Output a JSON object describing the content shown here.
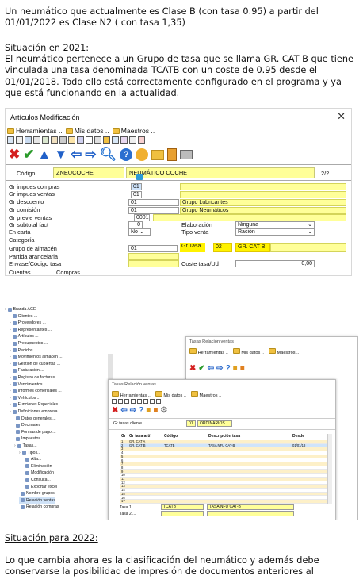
{
  "intro": "Un neumático que actualmente es Clase B (con tasa 0.95) a partir del 01/01/2022 es Clase N2 ( con tasa 1,35)",
  "h2021": "Situación en 2021:",
  "p2021": "El neumático pertenece a un Grupo de tasa que se llama GR. CAT B que tiene vinculada una tasa denominada TCATB con un coste de 0.95 desde el 01/01/2018. Todo ello está correctamente configurado en el programa y ya que está funcionando en la actualidad.",
  "w1": {
    "title": "Artículos Modificación",
    "menu": [
      "Herramientas ..",
      "Mis datos ..",
      "Maestros .."
    ],
    "codigo_label": "Código",
    "codigo": "ZNEUCOCHE",
    "desc": "NEUMÁTICO COCHE",
    "page": "2/2",
    "labels": [
      "Gr impues compras",
      "Gr impues ventas",
      "Gr descuento",
      "Gr comisión",
      "Gr previe ventas",
      "Gr subtotal fact",
      "En carta",
      "Categoría",
      "Grupo de almacén",
      "Partida arancelaria",
      "Envase/Código tasa",
      "Cuentas",
      "Compras"
    ],
    "v_imp_compras": "01",
    "v_imp_ventas": "01",
    "v_desc": "01",
    "v_com": "01",
    "v_previe": "0001",
    "v_subtotal": "0",
    "v_carta": "No",
    "v_almacen": "01",
    "grupo_lub": "Grupo Lubricantes",
    "grupo_neu": "Grupo Neumáticos",
    "elab_label": "Elaboración",
    "elab": "Ninguna",
    "tipoventa_label": "Tipo venta",
    "tipoventa": "Ración",
    "grtasa_label": "Gr Tasa",
    "grtasa_code": "02",
    "grtasa_name": "GR. CAT B",
    "coste_label": "Coste tasa/Ud",
    "coste": "0,00"
  },
  "w2": {
    "tree": [
      "Branda AGE",
      "Clientes ...",
      "Proveedores ...",
      "Representantes ...",
      "Artículos ...",
      "Presupuestos ...",
      "Pedidos ...",
      "Movimientos almacén ...",
      "Gestión de cubiertas ...",
      "Facturación ...",
      "Registro de facturas ...",
      "Vencimientos ...",
      "Informes comerciales ...",
      "Vehículos ...",
      "Funciones Especiales ...",
      "Definiciones empresa ...",
      "Datos generales ...",
      "Decimales",
      "Formas de pago ...",
      "Impuestos ...",
      "Tasas...",
      "Tipos...",
      "Alta...",
      "Eliminación",
      "Modificación",
      "Consulta...",
      "Exportar excel",
      "Nombre grupos",
      "Relación ventas",
      "Relación compras"
    ],
    "back_title": "Tasas Relación ventas",
    "front_title": "Tasas Relación ventas",
    "menu": [
      "Herramientas ..",
      "Mis datos ..",
      "Maestros .."
    ],
    "grupo_label": "Gr tasas cliente",
    "grupo_code": "01",
    "grupo_name": "ORDINARIOS",
    "cols": [
      "Gr",
      "Gr tasa artí",
      "Código",
      "Descripción tasa",
      "Desde"
    ],
    "rows": [
      {
        "n": "1",
        "gr": "GR. CAT A",
        "cod": "",
        "desc": "",
        "desde": ""
      },
      {
        "n": "2",
        "gr": "GR. CAT B",
        "cod": "TCATB",
        "desc": "TASA NFU CAT-B",
        "desde": "01/01/18"
      },
      {
        "n": "3",
        "gr": "",
        "cod": "",
        "desc": "",
        "desde": ""
      },
      {
        "n": "4",
        "gr": "",
        "cod": "",
        "desc": "",
        "desde": ""
      },
      {
        "n": "5",
        "gr": "",
        "cod": "",
        "desc": "",
        "desde": ""
      },
      {
        "n": "6",
        "gr": "",
        "cod": "",
        "desc": "",
        "desde": ""
      },
      {
        "n": "7",
        "gr": "",
        "cod": "",
        "desc": "",
        "desde": ""
      },
      {
        "n": "8",
        "gr": "",
        "cod": "",
        "desc": "",
        "desde": ""
      },
      {
        "n": "9",
        "gr": "",
        "cod": "",
        "desc": "",
        "desde": ""
      },
      {
        "n": "10",
        "gr": "",
        "cod": "",
        "desc": "",
        "desde": ""
      },
      {
        "n": "11",
        "gr": "",
        "cod": "",
        "desc": "",
        "desde": ""
      },
      {
        "n": "12",
        "gr": "",
        "cod": "",
        "desc": "",
        "desde": ""
      },
      {
        "n": "13",
        "gr": "",
        "cod": "",
        "desc": "",
        "desde": ""
      },
      {
        "n": "14",
        "gr": "",
        "cod": "",
        "desc": "",
        "desde": ""
      },
      {
        "n": "15",
        "gr": "",
        "cod": "",
        "desc": "",
        "desde": ""
      },
      {
        "n": "16",
        "gr": "",
        "cod": "",
        "desc": "",
        "desde": ""
      },
      {
        "n": "17",
        "gr": "",
        "cod": "",
        "desc": "",
        "desde": ""
      }
    ],
    "tasa1_label": "Tasa 1",
    "tasa1_cod": "TCATB",
    "tasa1_desc": "TASA NFU CAT-B",
    "tasa2_label": "Tasa 2 ..."
  },
  "h2022": "Situación para 2022:",
  "p2022": "Lo que cambia ahora es la clasificación del neumático y además debe conservarse la posibilidad de impresión de documentos anteriores al"
}
